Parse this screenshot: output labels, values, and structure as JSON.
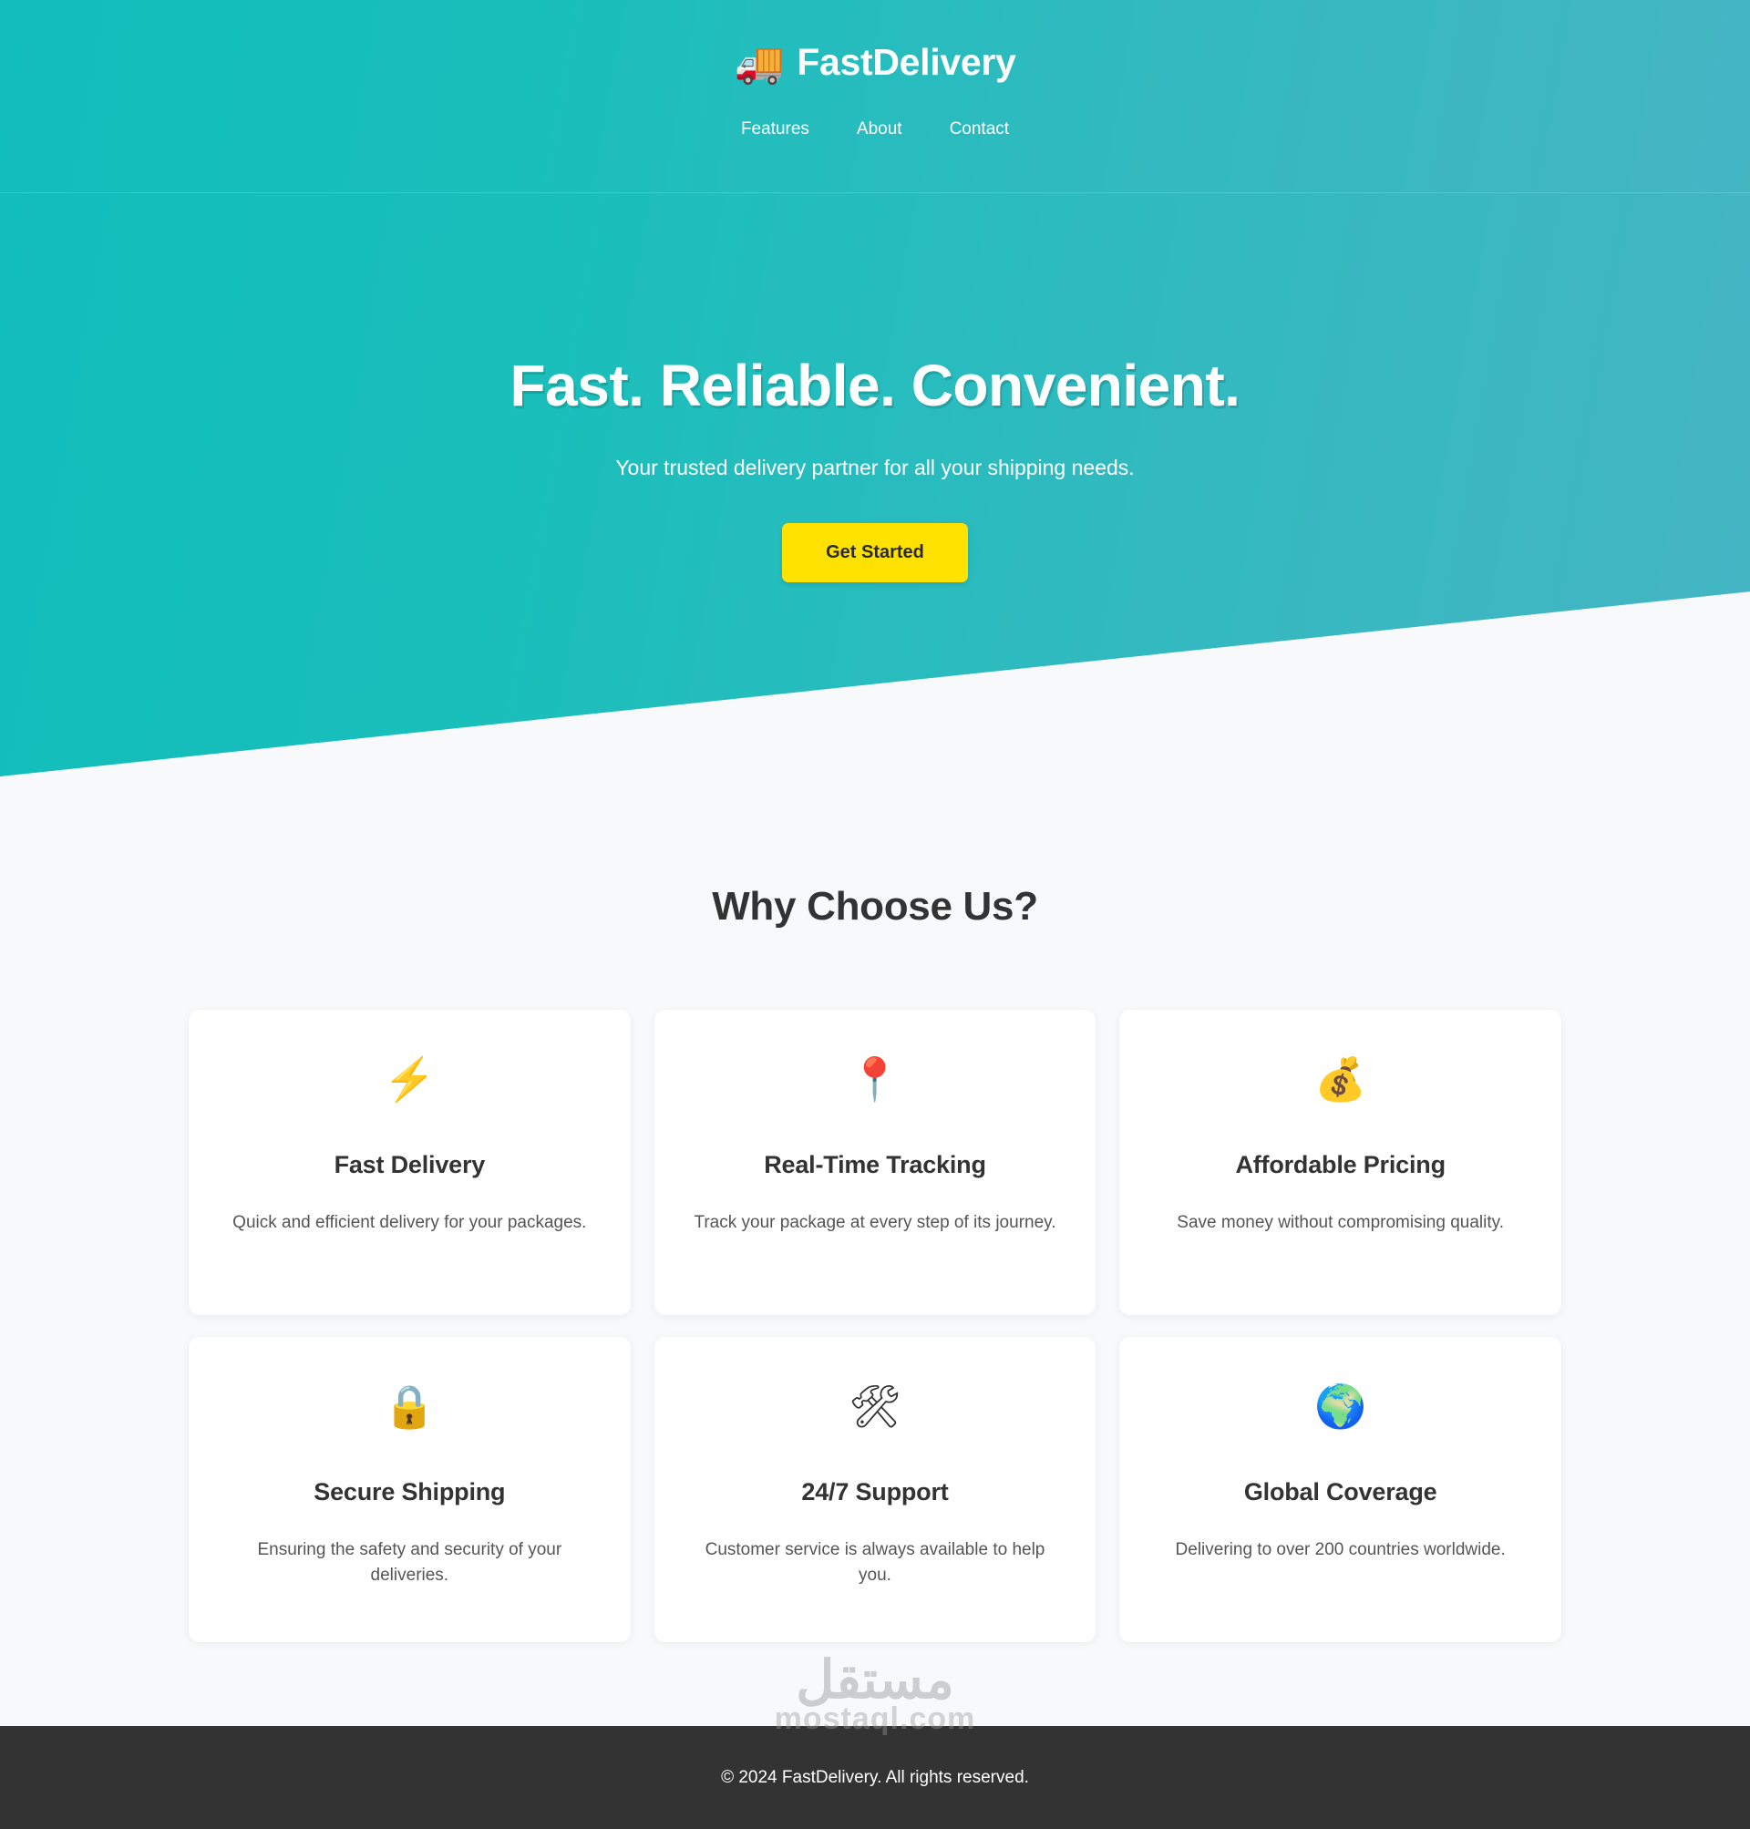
{
  "header": {
    "brand_icon": "delivery-truck-icon",
    "brand_icon_glyph": "🚚",
    "brand_name": "FastDelivery",
    "nav": [
      {
        "label": "Features"
      },
      {
        "label": "About"
      },
      {
        "label": "Contact"
      }
    ]
  },
  "hero": {
    "title": "Fast. Reliable. Convenient.",
    "subtitle": "Your trusted delivery partner for all your shipping needs.",
    "cta_label": "Get Started"
  },
  "features": {
    "section_title": "Why Choose Us?",
    "cards": [
      {
        "icon_name": "lightning-bolt-icon",
        "icon_glyph": "⚡",
        "title": "Fast Delivery",
        "description": "Quick and efficient delivery for your packages."
      },
      {
        "icon_name": "map-pin-icon",
        "icon_glyph": "📍",
        "title": "Real-Time Tracking",
        "description": "Track your package at every step of its journey."
      },
      {
        "icon_name": "money-bag-icon",
        "icon_glyph": "💰",
        "title": "Affordable Pricing",
        "description": "Save money without compromising quality."
      },
      {
        "icon_name": "lock-icon",
        "icon_glyph": "🔒",
        "title": "Secure Shipping",
        "description": "Ensuring the safety and security of your deliveries."
      },
      {
        "icon_name": "hammer-and-wrench-icon",
        "icon_glyph": "🛠",
        "title": "24/7 Support",
        "description": "Customer service is always available to help you."
      },
      {
        "icon_name": "globe-icon",
        "icon_glyph": "🌍",
        "title": "Global Coverage",
        "description": "Delivering to over 200 countries worldwide."
      }
    ]
  },
  "footer": {
    "copyright": "© 2024 FastDelivery. All rights reserved."
  },
  "watermark": {
    "arabic": "مستقل",
    "latin": "mostaql.com"
  },
  "colors": {
    "teal_left": "#11bdbb",
    "teal_right": "#45b5c4",
    "cta_yellow": "#ffe200",
    "page_bg": "#f8f9fa",
    "footer_bg": "#333333",
    "text_dark": "#333333"
  }
}
